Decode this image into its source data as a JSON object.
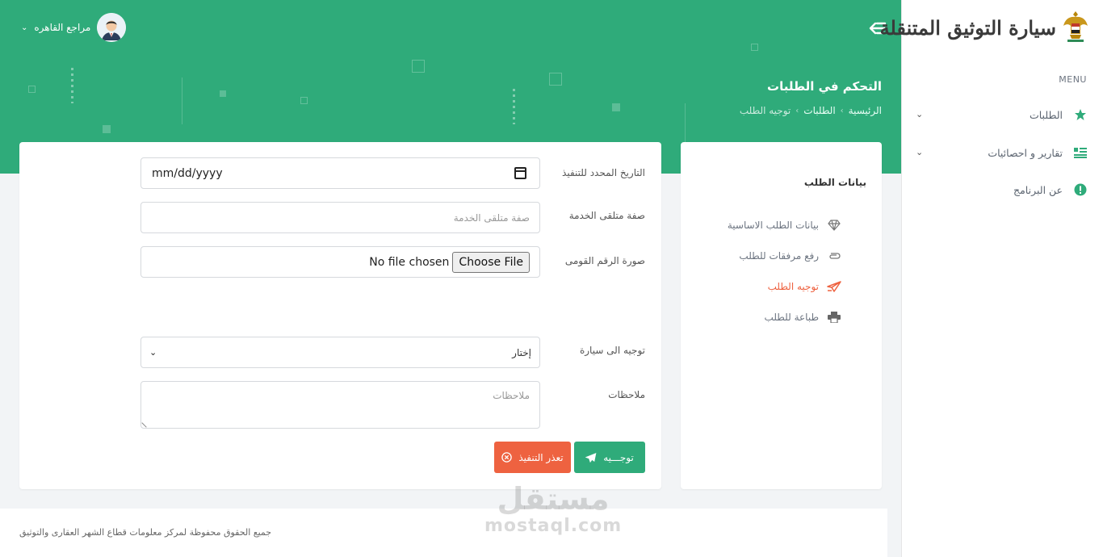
{
  "app": {
    "title": "سيارة التوثيق المتنقلة"
  },
  "sidebar": {
    "menu_label": "MENU",
    "items": [
      {
        "label": "الطلبات",
        "icon": "star-icon",
        "has_chevron": true
      },
      {
        "label": "تقارير و احصائيات",
        "icon": "list-icon",
        "has_chevron": true
      },
      {
        "label": "عن البرنامج",
        "icon": "info-icon",
        "has_chevron": false
      }
    ]
  },
  "header": {
    "user_name": "مراجع القاهره",
    "page_title": "التحكم في الطلبات",
    "breadcrumb": [
      "الرئيسية",
      "الطلبات",
      "توجيه الطلب"
    ]
  },
  "steps": {
    "title": "بيانات الطلب",
    "items": [
      {
        "label": "بيانات الطلب الاساسية",
        "icon": "diamond-icon",
        "active": false
      },
      {
        "label": "رفع مرفقات للطلب",
        "icon": "paperclip-icon",
        "active": false
      },
      {
        "label": "توجيه الطلب",
        "icon": "send-icon",
        "active": true
      },
      {
        "label": "طباعة للطلب",
        "icon": "print-icon",
        "active": false
      }
    ]
  },
  "form": {
    "date_label": "التاريخ المحدد للتنفيذ",
    "date_value": "mm/dd/yyyy",
    "role_label": "صفة متلقى الخدمة",
    "role_placeholder": "صفة متلقى الخدمة",
    "id_label": "صورة الرقم القومى",
    "file_button": "Choose File",
    "file_status": "No file chosen",
    "car_label": "توجيه الى سيارة",
    "car_selected": "إختار",
    "notes_label": "ملاحظات",
    "notes_placeholder": "ملاحظات",
    "send_button": "توجـــيه",
    "cancel_button": "تعذر التنفيذ"
  },
  "footer": {
    "copyright": "جميع الحقوق محفوظة لمركز معلومات قطاع الشهر العقارى والتوثيق"
  },
  "watermark": {
    "ar": "مستقل",
    "en": "mostaql.com"
  },
  "colors": {
    "primary": "#2fab7a",
    "danger": "#ee6240"
  }
}
